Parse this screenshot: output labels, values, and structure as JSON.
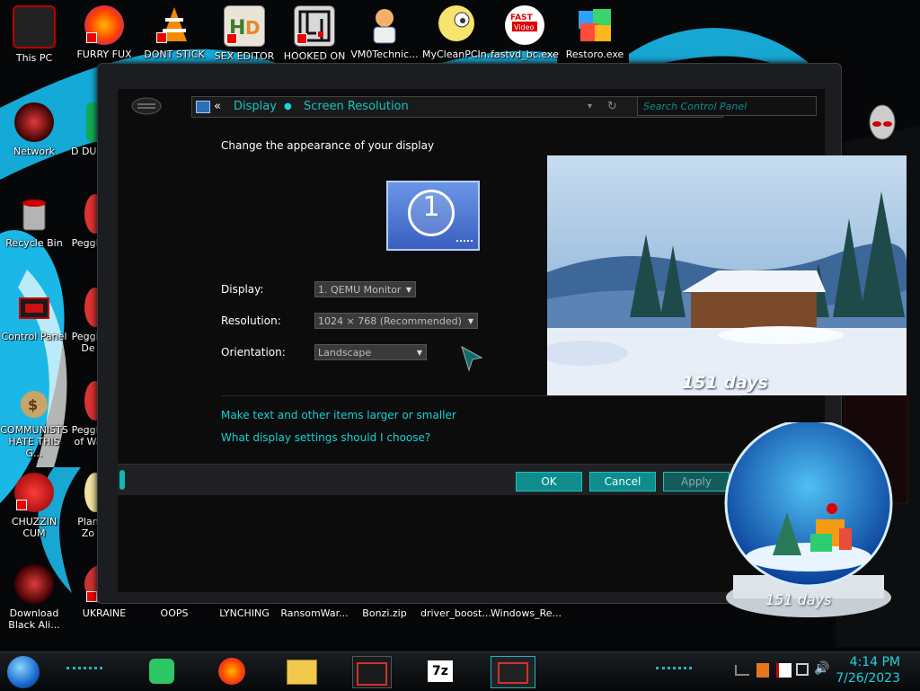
{
  "desktop": {
    "icons_top": [
      {
        "label": "This PC"
      },
      {
        "label": "FURRY FUX"
      },
      {
        "label": "DONT STICK"
      },
      {
        "label": "SEX EDITOR"
      },
      {
        "label": "HOOKED ON"
      },
      {
        "label": "VM0Technic..."
      },
      {
        "label": "MyCleanPCIn..."
      },
      {
        "label": "fastvd_bc.exe"
      },
      {
        "label": "Restoro.exe"
      }
    ],
    "icons_left": [
      {
        "label": "Network"
      },
      {
        "label": "Recycle Bin"
      },
      {
        "label": "Control Panel"
      },
      {
        "label": "COMMUNISTS HATE THIS G..."
      },
      {
        "label": "CHUZZIN CUM"
      },
      {
        "label": "Download Black Ali..."
      }
    ],
    "icons_col2": [
      {
        "label": "D DUM"
      },
      {
        "label": "Peggle"
      },
      {
        "label": "Peggle De"
      },
      {
        "label": "Peggle of Wa"
      },
      {
        "label": "Plan Zo"
      },
      {
        "label": "UKRAINE"
      }
    ],
    "icons_bottom": [
      {
        "label": "OOPS"
      },
      {
        "label": "LYNCHING"
      },
      {
        "label": "RansomWar..."
      },
      {
        "label": "Bonzi.zip"
      },
      {
        "label": "driver_boost..."
      },
      {
        "label": "Windows_Re..."
      }
    ],
    "gadget_days_top": "151 days",
    "gadget_days_globe": "151 days"
  },
  "window": {
    "breadcrumb_sep": "«",
    "breadcrumb_display": "Display",
    "breadcrumb_screen_resolution": "Screen Resolution",
    "search_placeholder": "Search Control Panel",
    "heading": "Change the appearance of your display",
    "monitor_number": "1",
    "display_label": "Display:",
    "display_value": "1. QEMU Monitor",
    "resolution_label": "Resolution:",
    "resolution_value": "1024 × 768 (Recommended)",
    "orientation_label": "Orientation:",
    "orientation_value": "Landscape",
    "link_text_size": "Make text and other items larger or smaller",
    "link_what_settings": "What display settings should I choose?",
    "ok": "OK",
    "cancel": "Cancel",
    "apply": "Apply"
  },
  "taskbar": {
    "time": "4:14 PM",
    "date": "7/26/2023"
  },
  "colors": {
    "accent": "#15d2d6",
    "button": "#0f8c8b"
  }
}
